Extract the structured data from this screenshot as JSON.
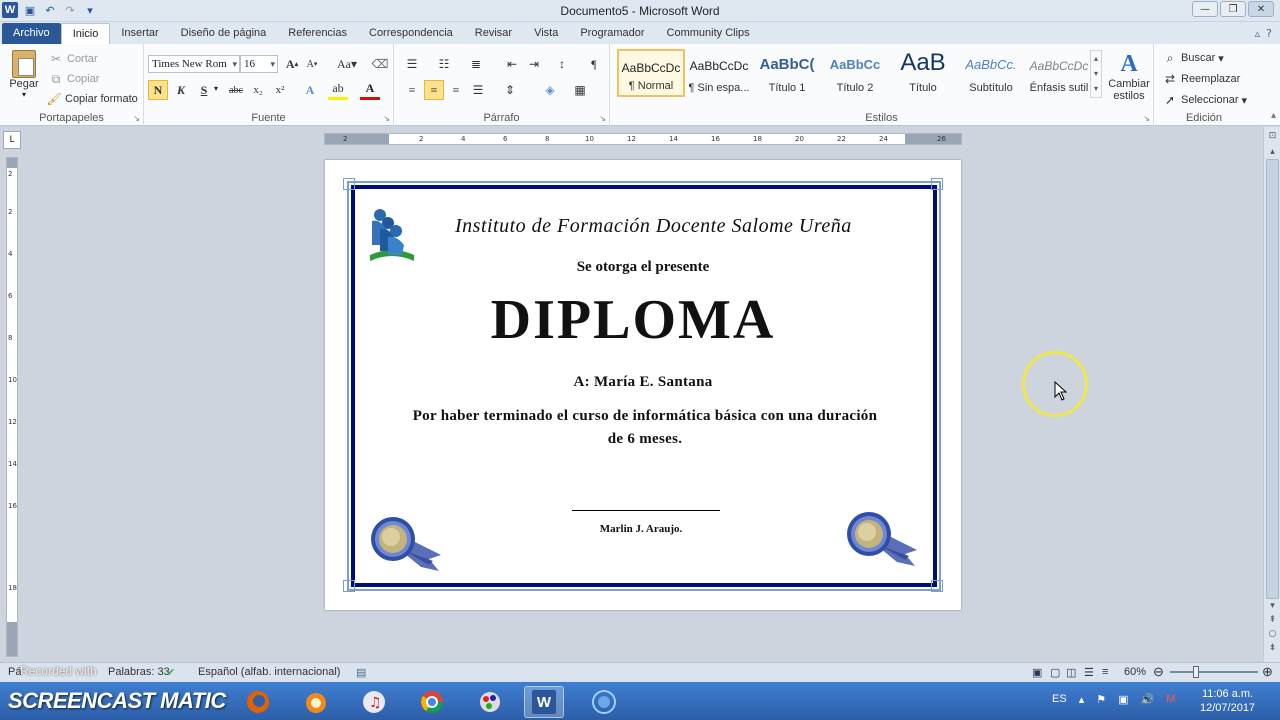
{
  "window": {
    "title": "Documento5 - Microsoft Word",
    "quick_access": [
      "save-icon",
      "undo-icon",
      "redo-icon",
      "customize-icon"
    ]
  },
  "tabs": [
    "Archivo",
    "Inicio",
    "Insertar",
    "Diseño de página",
    "Referencias",
    "Correspondencia",
    "Revisar",
    "Vista",
    "Programador",
    "Community Clips"
  ],
  "ribbon": {
    "clipboard": {
      "paste": "Pegar",
      "cut": "Cortar",
      "copy": "Copiar",
      "format_painter": "Copiar formato",
      "label": "Portapapeles"
    },
    "font": {
      "name": "Times New Rom",
      "size": "16",
      "label": "Fuente",
      "bold": "N",
      "italic": "K",
      "underline": "S",
      "strike": "abc",
      "sub": "x₂",
      "sup": "x²",
      "grow": "A",
      "shrink": "A",
      "case": "Aa"
    },
    "paragraph": {
      "label": "Párrafo"
    },
    "styles": {
      "label": "Estilos",
      "items": [
        {
          "preview": "AaBbCcDc",
          "name": "¶ Normal"
        },
        {
          "preview": "AaBbCcDc",
          "name": "¶ Sin espa..."
        },
        {
          "preview": "AaBbC(",
          "name": "Título 1"
        },
        {
          "preview": "AaBbCc",
          "name": "Título 2"
        },
        {
          "preview": "AaB",
          "name": "Título"
        },
        {
          "preview": "AaBbCc.",
          "name": "Subtítulo"
        },
        {
          "preview": "AaBbCcDc",
          "name": "Énfasis sutil"
        }
      ],
      "change": "Cambiar estilos"
    },
    "editing": {
      "find": "Buscar",
      "replace": "Reemplazar",
      "select": "Seleccionar",
      "label": "Edición"
    }
  },
  "document": {
    "institute": "Instituto de Formación Docente Salome Ureña",
    "intro": "Se otorga el presente",
    "headline": "DIPLOMA",
    "recipient": "A: María E. Santana",
    "reason": "Por haber terminado el curso de informática básica con una duración de 6 meses.",
    "signer": "Marlin J. Araujo.",
    "hruler_ticks": [
      "2",
      "2",
      "4",
      "6",
      "8",
      "10",
      "12",
      "14",
      "16",
      "18",
      "20",
      "22",
      "24",
      "26"
    ],
    "vruler_ticks": [
      "2",
      "2",
      "4",
      "6",
      "8",
      "10",
      "12",
      "14",
      "16",
      "18"
    ]
  },
  "statusbar": {
    "words": "Palabras: 33",
    "page": "Pá",
    "language": "Español (alfab. internacional)",
    "zoom": "60%"
  },
  "watermark": "Recorded with",
  "taskbar": {
    "screencast": "SCREENCAST  MATIC",
    "language": "ES",
    "time": "11:06 a.m.",
    "date": "12/07/2017"
  },
  "colors": {
    "frame": "#000c7a",
    "file_tab": "#2b5797",
    "accent": "#2b579a"
  }
}
